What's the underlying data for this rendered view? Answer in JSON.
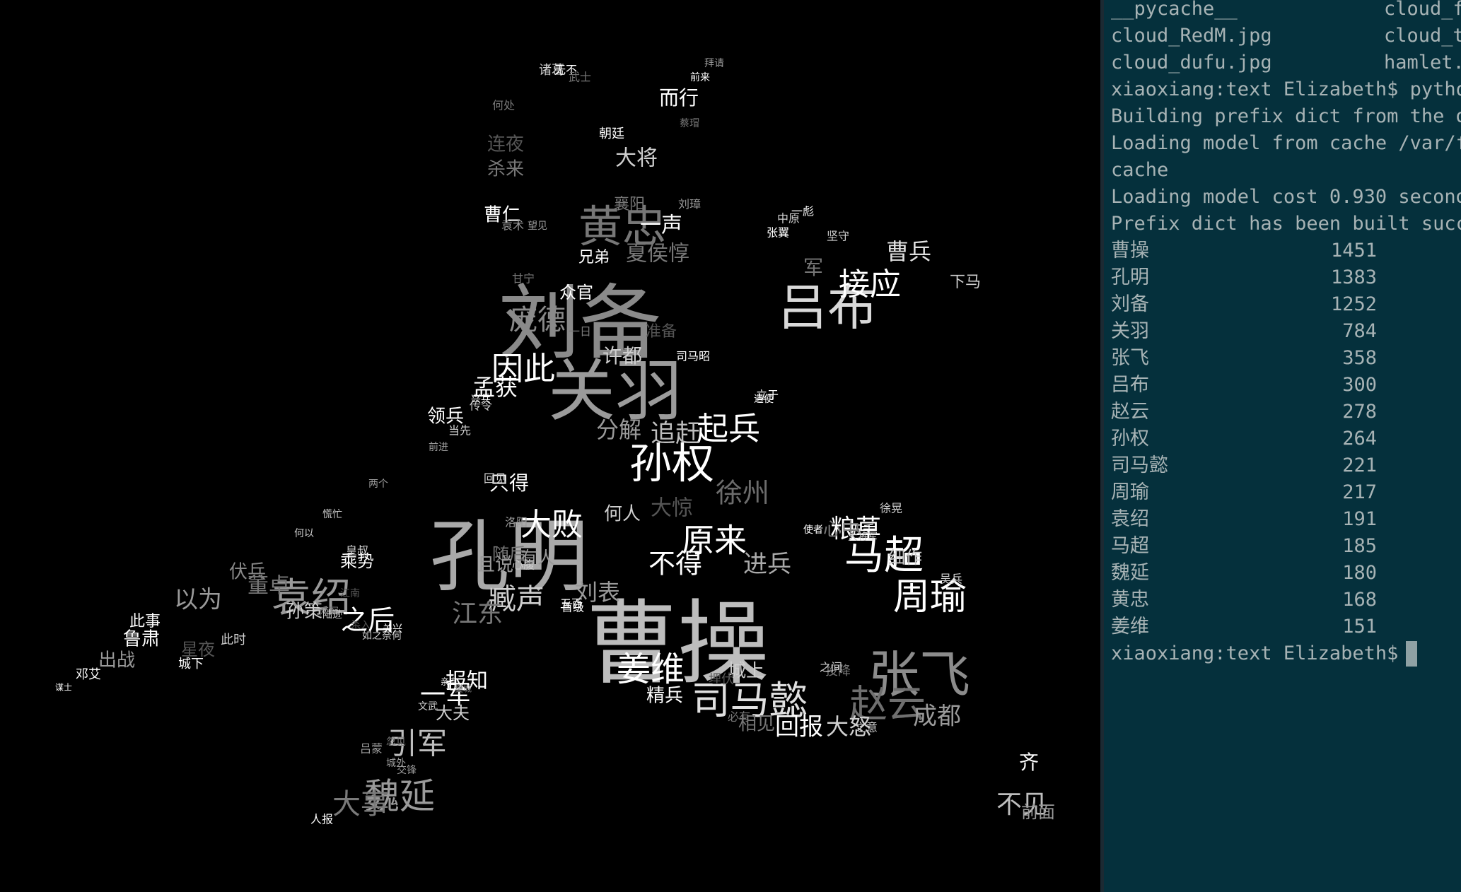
{
  "terminal": {
    "listing": [
      {
        "left": "__pycache__",
        "right": "cloud_f"
      },
      {
        "left": "cloud_RedM.jpg",
        "right": "cloud_t"
      },
      {
        "left": "cloud_dufu.jpg",
        "right": "hamlet."
      }
    ],
    "prompt_command": "xiaoxiang:text Elizabeth$ pytho",
    "log_lines": [
      "Building prefix dict from the d",
      "Loading model from cache /var/f",
      "cache",
      "Loading model cost 0.930 second",
      "Prefix dict has been built succ"
    ],
    "counts": [
      {
        "name": "曹操",
        "count": "1451"
      },
      {
        "name": "孔明",
        "count": "1383"
      },
      {
        "name": "刘备",
        "count": "1252"
      },
      {
        "name": "关羽",
        "count": "784"
      },
      {
        "name": "张飞",
        "count": "358"
      },
      {
        "name": "吕布",
        "count": "300"
      },
      {
        "name": "赵云",
        "count": "278"
      },
      {
        "name": "孙权",
        "count": "264"
      },
      {
        "name": "司马懿",
        "count": "221"
      },
      {
        "name": "周瑜",
        "count": "217"
      },
      {
        "name": "袁绍",
        "count": "191"
      },
      {
        "name": "马超",
        "count": "185"
      },
      {
        "name": "魏延",
        "count": "180"
      },
      {
        "name": "黄忠",
        "count": "168"
      },
      {
        "name": "姜维",
        "count": "151"
      }
    ],
    "final_prompt": "xiaoxiang:text Elizabeth$"
  },
  "colors": {
    "terminal_bg": "#05303c",
    "terminal_text": "#a7b3b5",
    "cloud_bg": "#000000"
  },
  "word_cloud": [
    {
      "t": "曹操",
      "c": "#bdbdbd"
    },
    {
      "t": "孔明",
      "c": "#a9a9a9"
    },
    {
      "t": "刘备",
      "c": "#8a8a8a"
    },
    {
      "t": "关羽",
      "c": "#9b9b9b"
    },
    {
      "t": "吕布",
      "c": "#d9d9d9"
    },
    {
      "t": "张飞",
      "c": "#8c8c8c"
    },
    {
      "t": "赵云",
      "c": "#6f6f6f"
    },
    {
      "t": "孙权",
      "c": "#ffffff"
    },
    {
      "t": "司马懿",
      "c": "#e0e0e0"
    },
    {
      "t": "周瑜",
      "c": "#ffffff"
    },
    {
      "t": "袁绍",
      "c": "#9a9a9a"
    },
    {
      "t": "马超",
      "c": "#ffffff"
    },
    {
      "t": "魏延",
      "c": "#9a9a9a"
    },
    {
      "t": "黄忠",
      "c": "#777777"
    },
    {
      "t": "姜维",
      "c": "#ffffff"
    },
    {
      "t": "因此",
      "c": "#ffffff"
    },
    {
      "t": "接应",
      "c": "#ffffff"
    },
    {
      "t": "庞德",
      "c": "#8a8a8a"
    },
    {
      "t": "原来",
      "c": "#ffffff"
    },
    {
      "t": "臧声",
      "c": "#cfcfcf"
    },
    {
      "t": "不得",
      "c": "#ffffff"
    },
    {
      "t": "进兵",
      "c": "#aaaaaa"
    },
    {
      "t": "徐州",
      "c": "#6c6c6c"
    },
    {
      "t": "大惊",
      "c": "#555555"
    },
    {
      "t": "大败",
      "c": "#ffffff"
    },
    {
      "t": "起兵",
      "c": "#ffffff"
    },
    {
      "t": "追赶",
      "c": "#bdbdbd"
    },
    {
      "t": "分解",
      "c": "#9a9a9a"
    },
    {
      "t": "夏侯惇",
      "c": "#777777"
    },
    {
      "t": "曹兵",
      "c": "#e0e0e0"
    },
    {
      "t": "大将",
      "c": "#cfcfcf"
    },
    {
      "t": "一声",
      "c": "#ffffff"
    },
    {
      "t": "粮草",
      "c": "#ffffff"
    },
    {
      "t": "大事",
      "c": "#7a7a7a"
    },
    {
      "t": "之后",
      "c": "#ffffff"
    },
    {
      "t": "报知",
      "c": "#ffffff"
    },
    {
      "t": "回报",
      "c": "#ffffff"
    },
    {
      "t": "大怒",
      "c": "#cfcfcf"
    },
    {
      "t": "成都",
      "c": "#9a9a9a"
    },
    {
      "t": "不见",
      "c": "#bdbdbd"
    },
    {
      "t": "前面",
      "c": "#9a9a9a"
    },
    {
      "t": "孟获",
      "c": "#ffffff"
    },
    {
      "t": "领兵",
      "c": "#ffffff"
    },
    {
      "t": "鲁肃",
      "c": "#ffffff"
    },
    {
      "t": "出战",
      "c": "#9a9a9a"
    },
    {
      "t": "以为",
      "c": "#9a9a9a"
    },
    {
      "t": "伏兵",
      "c": "#888888"
    },
    {
      "t": "董卓",
      "c": "#777777"
    },
    {
      "t": "孙策",
      "c": "#cfcfcf"
    },
    {
      "t": "乘势",
      "c": "#ffffff"
    },
    {
      "t": "刘表",
      "c": "#9a9a9a"
    },
    {
      "t": "许都",
      "c": "#cfcfcf"
    },
    {
      "t": "只得",
      "c": "#ffffff"
    },
    {
      "t": "引军",
      "c": "#bdbdbd"
    },
    {
      "t": "一军",
      "c": "#ffffff"
    },
    {
      "t": "江东",
      "c": "#777777"
    },
    {
      "t": "何人",
      "c": "#cfcfcf"
    },
    {
      "t": "城上",
      "c": "#cfcfcf"
    },
    {
      "t": "精兵",
      "c": "#ffffff"
    },
    {
      "t": "相见",
      "c": "#777777"
    },
    {
      "t": "五千",
      "c": "#ffffff"
    },
    {
      "t": "兄弟",
      "c": "#ffffff"
    },
    {
      "t": "众官",
      "c": "#ffffff"
    },
    {
      "t": "准备",
      "c": "#555555"
    },
    {
      "t": "而行",
      "c": "#ffffff"
    },
    {
      "t": "襄阳",
      "c": "#777777"
    },
    {
      "t": "诸葛",
      "c": "#cfcfcf"
    },
    {
      "t": "此事",
      "c": "#ffffff"
    },
    {
      "t": "邓艾",
      "c": "#ffffff"
    },
    {
      "t": "星夜",
      "c": "#555555"
    },
    {
      "t": "此时",
      "c": "#cfcfcf"
    },
    {
      "t": "城下",
      "c": "#ffffff"
    },
    {
      "t": "心中",
      "c": "#777777"
    },
    {
      "t": "大夫",
      "c": "#cfcfcf"
    },
    {
      "t": "人报",
      "c": "#ffffff"
    },
    {
      "t": "齐",
      "c": "#ffffff"
    },
    {
      "t": "两个",
      "c": "#9a9a9a"
    },
    {
      "t": "何以",
      "c": "#cfcfcf"
    },
    {
      "t": "慌忙",
      "c": "#cfcfcf"
    },
    {
      "t": "谋士",
      "c": "#ffffff"
    },
    {
      "t": "回见",
      "c": "#cfcfcf"
    },
    {
      "t": "前进",
      "c": "#9a9a9a"
    },
    {
      "t": "兴兵",
      "c": "#ffffff"
    },
    {
      "t": "当先",
      "c": "#cfcfcf"
    },
    {
      "t": "传令",
      "c": "#cfcfcf"
    },
    {
      "t": "甘宁",
      "c": "#777777"
    },
    {
      "t": "无不",
      "c": "#ffffff"
    },
    {
      "t": "武士",
      "c": "#777777"
    },
    {
      "t": "朝廷",
      "c": "#ffffff"
    },
    {
      "t": "刘璋",
      "c": "#9a9a9a"
    },
    {
      "t": "中原",
      "c": "#cfcfcf"
    },
    {
      "t": "坚守",
      "c": "#cfcfcf"
    },
    {
      "t": "张翼",
      "c": "#ffffff"
    },
    {
      "t": "一彪",
      "c": "#ffffff"
    },
    {
      "t": "军",
      "c": "#777777"
    },
    {
      "t": "下马",
      "c": "#cfcfcf"
    },
    {
      "t": "一日",
      "c": "#777777"
    },
    {
      "t": "司马昭",
      "c": "#ffffff"
    },
    {
      "t": "立于",
      "c": "#ffffff"
    },
    {
      "t": "遣使",
      "c": "#ffffff"
    },
    {
      "t": "徐晃",
      "c": "#cfcfcf"
    },
    {
      "t": "大将军",
      "c": "#cfcfcf"
    },
    {
      "t": "使者",
      "c": "#ffffff"
    },
    {
      "t": "细作",
      "c": "#cfcfcf"
    },
    {
      "t": "吴兵",
      "c": "#cfcfcf"
    },
    {
      "t": "必有",
      "c": "#777777"
    },
    {
      "t": "之意",
      "c": "#cfcfcf"
    },
    {
      "t": "投降",
      "c": "#777777"
    },
    {
      "t": "之间",
      "c": "#cfcfcf"
    },
    {
      "t": "埋伏",
      "c": "#555555"
    },
    {
      "t": "首级",
      "c": "#ffffff"
    },
    {
      "t": "五百",
      "c": "#ffffff"
    },
    {
      "t": "随后",
      "c": "#777777"
    },
    {
      "t": "且说",
      "c": "#9a9a9a"
    },
    {
      "t": "洛阳",
      "c": "#9a9a9a"
    },
    {
      "t": "有人",
      "c": "#9a9a9a"
    },
    {
      "t": "心腹",
      "c": "#cfcfcf"
    },
    {
      "t": "皇叔",
      "c": "#cfcfcf"
    },
    {
      "t": "两军",
      "c": "#777777"
    },
    {
      "t": "陆逊",
      "c": "#cfcfcf"
    },
    {
      "t": "江南",
      "c": "#555555"
    },
    {
      "t": "杀入",
      "c": "#555555"
    },
    {
      "t": "如之奈何",
      "c": "#cfcfcf"
    },
    {
      "t": "关兴",
      "c": "#ffffff"
    },
    {
      "t": "吕蒙",
      "c": "#9a9a9a"
    },
    {
      "t": "交锋",
      "c": "#9a9a9a"
    },
    {
      "t": "城外",
      "c": "#9a9a9a"
    },
    {
      "t": "忽见",
      "c": "#777777"
    },
    {
      "t": "亲自",
      "c": "#ffffff"
    },
    {
      "t": "樊城",
      "c": "#777777"
    },
    {
      "t": "文武",
      "c": "#cfcfcf"
    },
    {
      "t": "曹仁",
      "c": "#ffffff"
    },
    {
      "t": "望见",
      "c": "#9a9a9a"
    },
    {
      "t": "杀来",
      "c": "#777777"
    },
    {
      "t": "连夜",
      "c": "#555555"
    },
    {
      "t": "何处",
      "c": "#777777"
    },
    {
      "t": "袁术",
      "c": "#9a9a9a"
    },
    {
      "t": "拜请",
      "c": "#9a9a9a"
    },
    {
      "t": "前来",
      "c": "#ffffff"
    },
    {
      "t": "蔡瑁",
      "c": "#777777"
    }
  ]
}
